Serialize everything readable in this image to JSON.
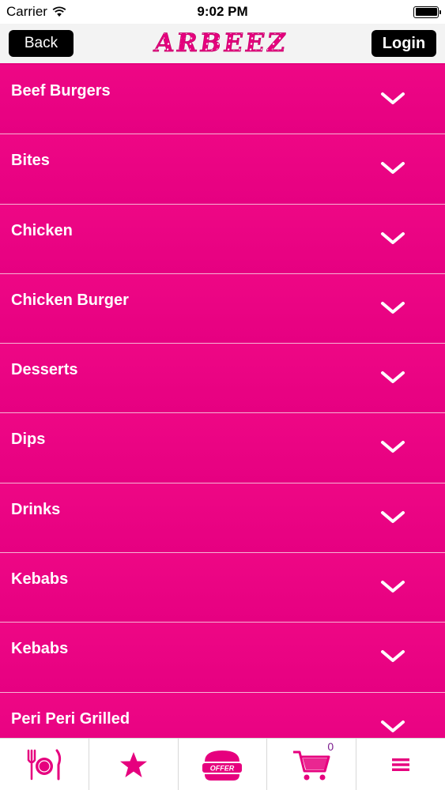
{
  "status_bar": {
    "carrier": "Carrier",
    "time": "9:02 PM"
  },
  "header": {
    "back_label": "Back",
    "logo_text": "ARBEEZ",
    "login_label": "Login"
  },
  "menu": {
    "items": [
      {
        "label": "Beef Burgers"
      },
      {
        "label": "Bites"
      },
      {
        "label": "Chicken"
      },
      {
        "label": "Chicken Burger"
      },
      {
        "label": "Desserts"
      },
      {
        "label": "Dips"
      },
      {
        "label": "Drinks"
      },
      {
        "label": "Kebabs"
      },
      {
        "label": "Kebabs"
      },
      {
        "label": "Peri Peri Grilled"
      }
    ]
  },
  "tab_bar": {
    "tabs": [
      {
        "icon": "plate-cutlery-icon"
      },
      {
        "icon": "star-icon"
      },
      {
        "icon": "offer-burger-icon",
        "badge_text": "OFFER"
      },
      {
        "icon": "cart-icon",
        "count": "0"
      },
      {
        "icon": "hamburger-menu-icon"
      }
    ]
  },
  "colors": {
    "brand": "#e6007e",
    "header_bg": "#f3f3f3",
    "button_bg": "#000000"
  }
}
